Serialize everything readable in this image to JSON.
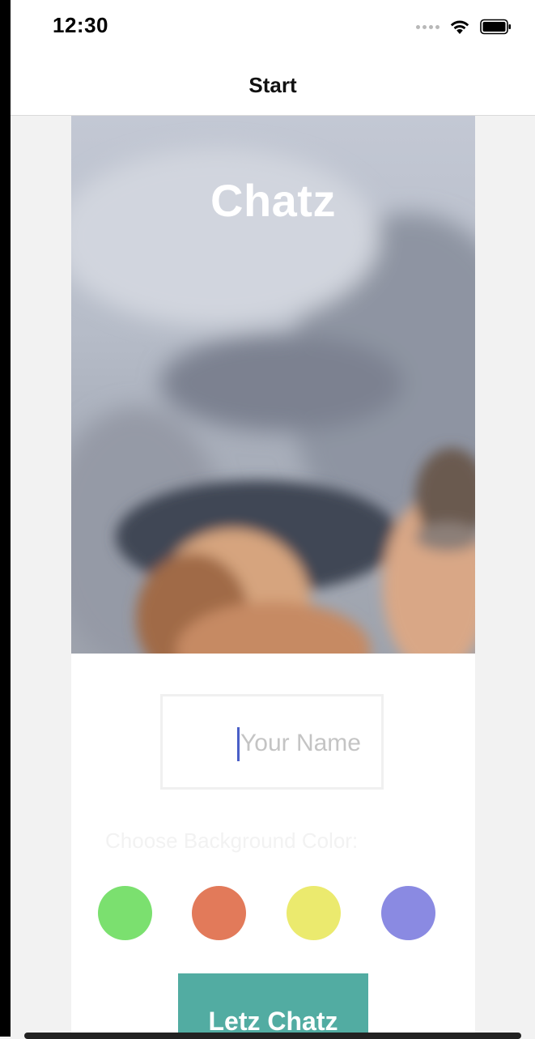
{
  "status_bar": {
    "time": "12:30",
    "icons": [
      "signal-dots-icon",
      "wifi-icon",
      "battery-icon"
    ]
  },
  "nav": {
    "title": "Start"
  },
  "hero": {
    "app_title": "Chatz"
  },
  "form": {
    "name_placeholder": "Your Name",
    "name_value": "",
    "color_label": "Choose Background Color:",
    "swatches": [
      {
        "name": "green",
        "color": "#7be06f"
      },
      {
        "name": "orange",
        "color": "#e27a5a"
      },
      {
        "name": "yellow",
        "color": "#ebea6e"
      },
      {
        "name": "purple",
        "color": "#8a8ae2"
      }
    ],
    "start_label": "Letz Chatz",
    "start_color": "#52aca2"
  }
}
